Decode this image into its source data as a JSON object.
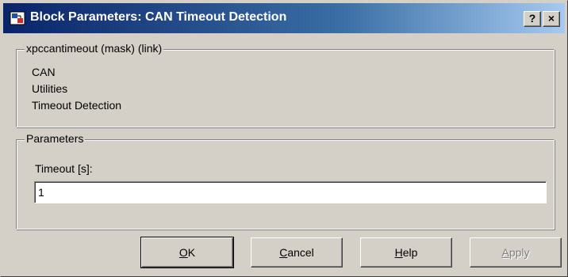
{
  "window": {
    "title": "Block Parameters: CAN Timeout Detection",
    "icon": "simulink-block-icon",
    "help_button": "?",
    "close_button": "×"
  },
  "description": {
    "legend": "xpccantimeout (mask) (link)",
    "lines": [
      "CAN",
      "Utilities",
      "Timeout Detection"
    ]
  },
  "parameters": {
    "legend": "Parameters",
    "timeout_label": "Timeout [s]:",
    "timeout_value": "1"
  },
  "buttons": {
    "ok": {
      "mnemonic": "O",
      "rest": "K"
    },
    "cancel": {
      "mnemonic": "C",
      "rest": "ancel"
    },
    "help": {
      "mnemonic": "H",
      "rest": "elp"
    },
    "apply": {
      "mnemonic": "A",
      "rest": "pply",
      "enabled": false
    }
  }
}
